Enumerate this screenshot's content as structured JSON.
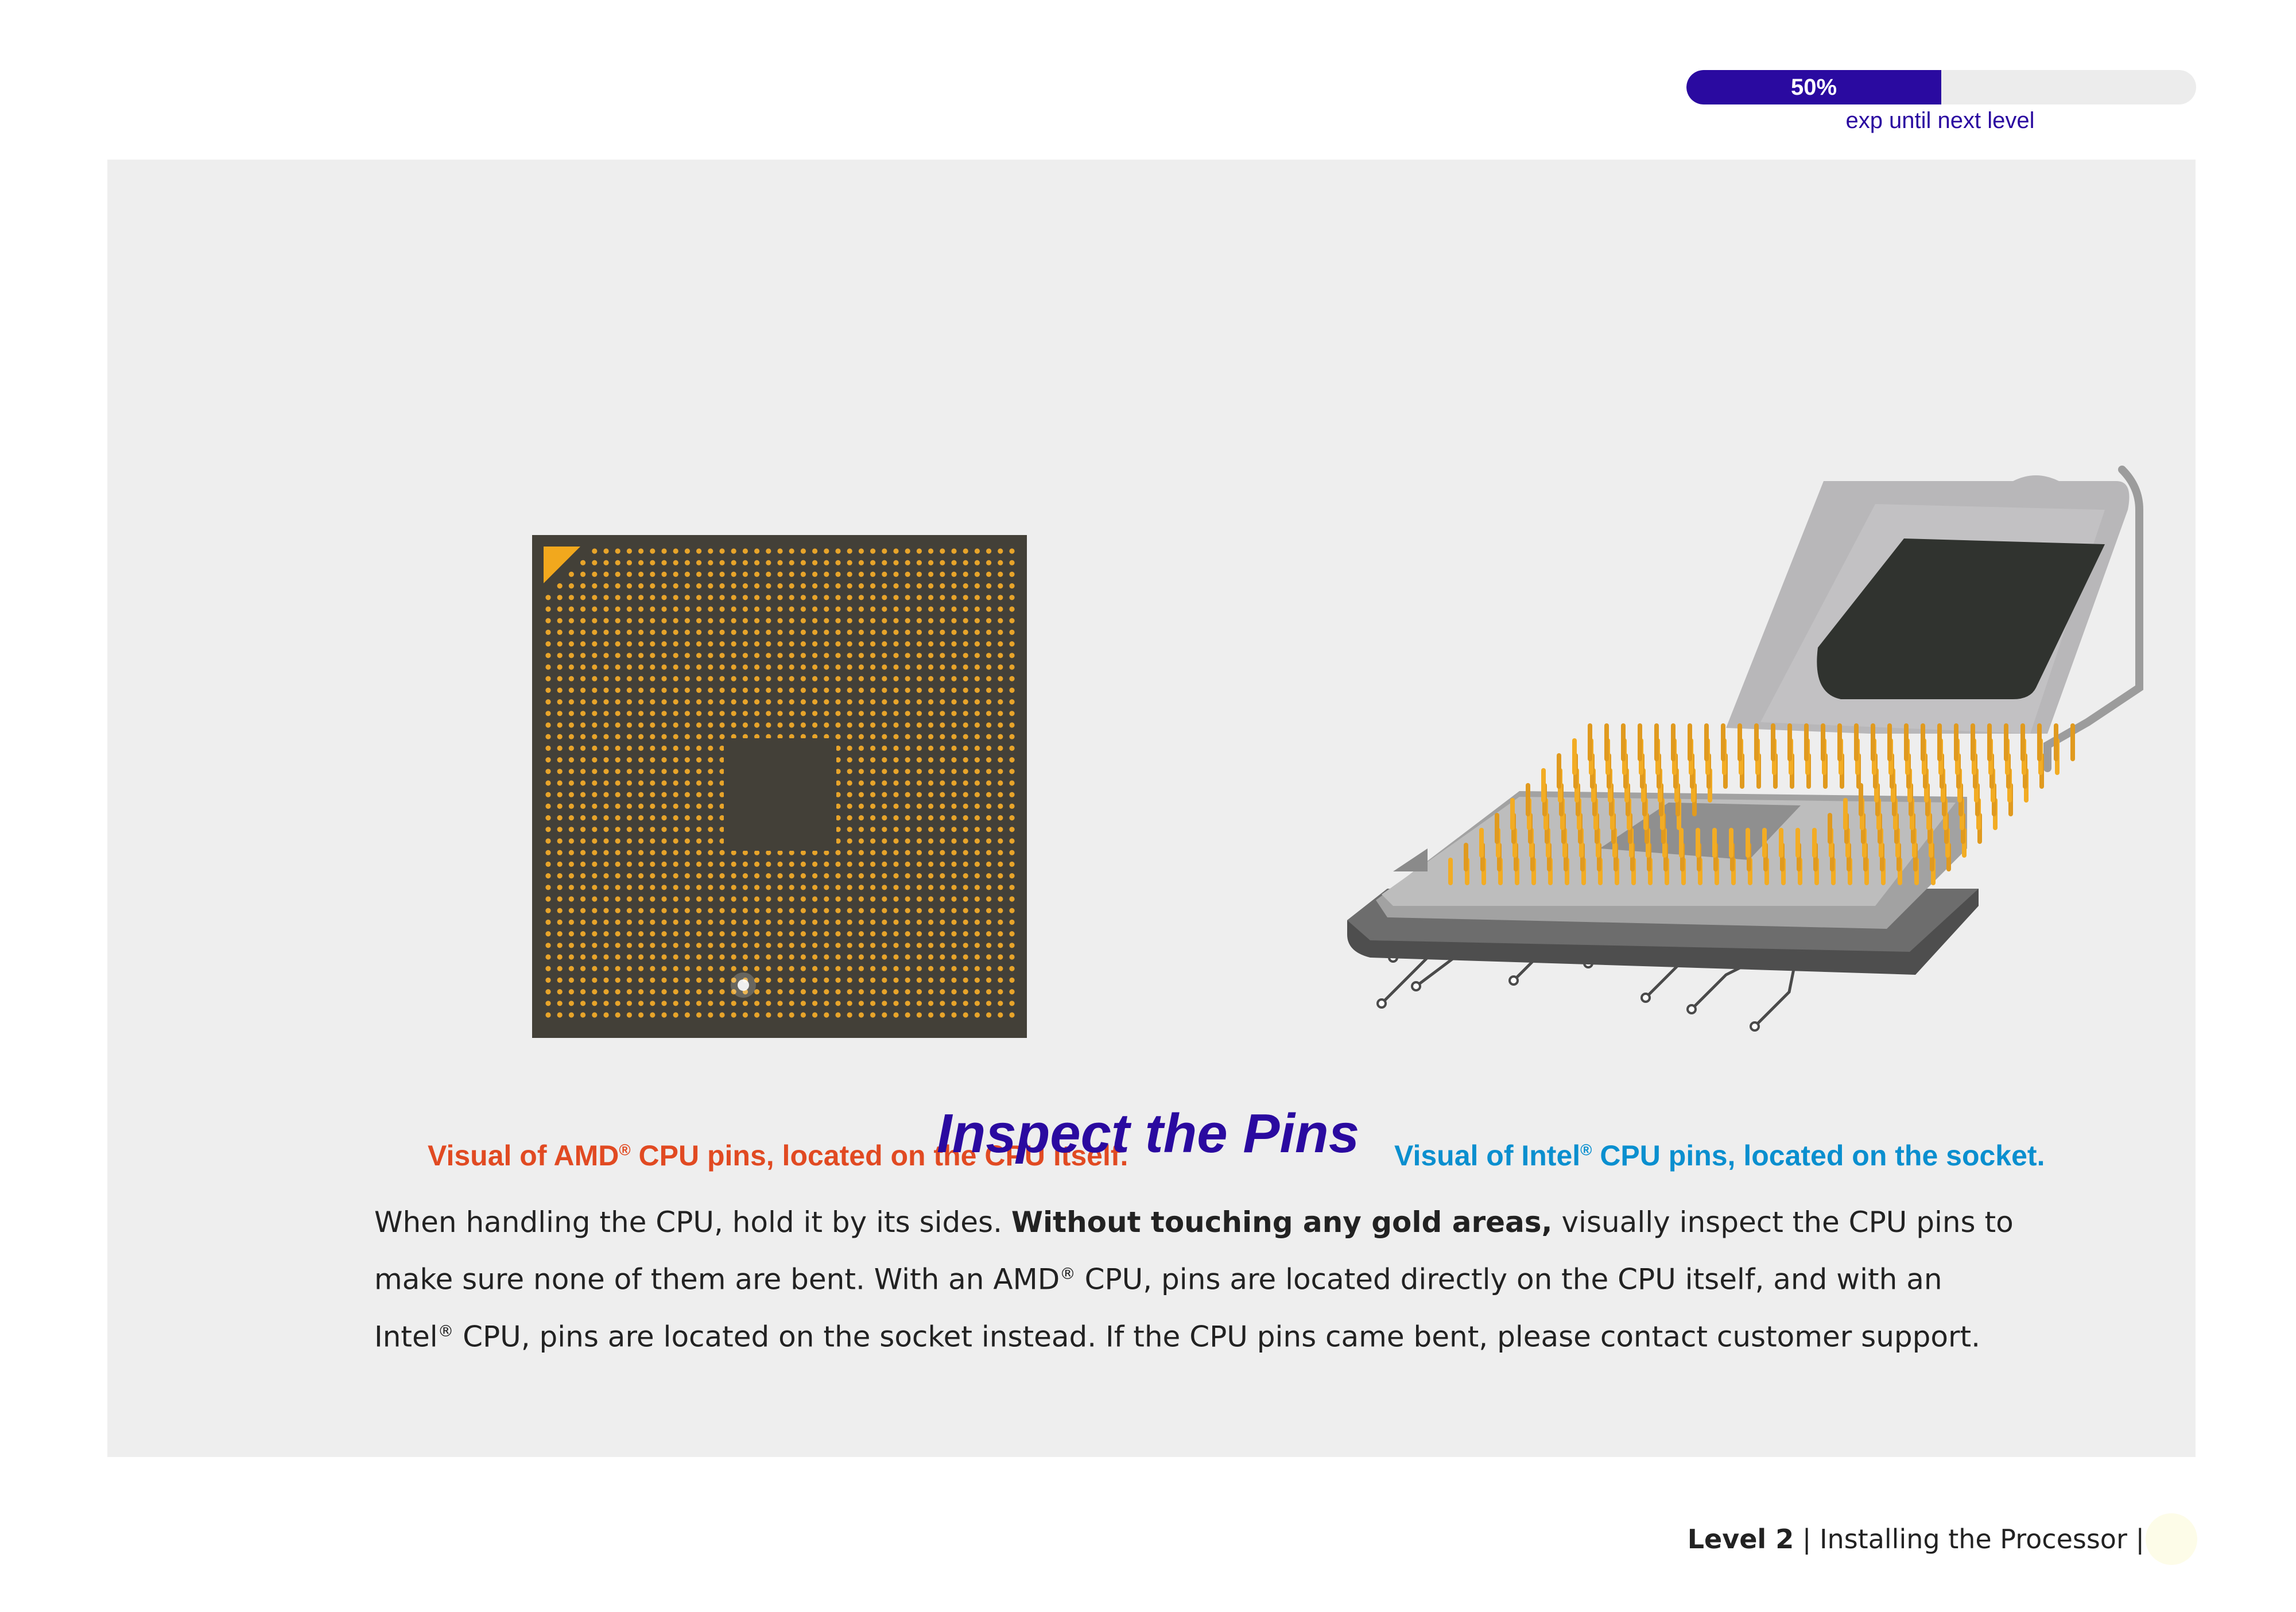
{
  "progress": {
    "percent_label": "50%",
    "value": 0.5,
    "subtitle": "exp until next level",
    "fill_color": "#2a0aa0"
  },
  "figures": {
    "amd_caption_a": "Visual of AMD",
    "amd_caption_reg": "®",
    "amd_caption_b": " CPU pins, located on the CPU itself.",
    "intel_caption_a": "Visual of Intel",
    "intel_caption_reg": "®",
    "intel_caption_b": " CPU pins, located on the socket."
  },
  "section": {
    "title": "Inspect the Pins",
    "line1_a": "When handling the CPU, hold it by its sides. ",
    "line1_bold": "Without touching any gold areas,",
    "line1_b": " visually inspect the CPU pins to",
    "line2_a": "make sure none of them are bent.  With an AMD",
    "line2_reg": "®",
    "line2_b": " CPU, pins are located directly on the CPU itself, and with an",
    "line3_a": "Intel",
    "line3_reg": "®",
    "line3_b": " CPU, pins are located on the socket instead. If the CPU pins came bent, please contact customer support."
  },
  "footer": {
    "level": "Level 2",
    "sep1": " | ",
    "chapter": "Installing the Processor",
    "sep2": " |"
  },
  "colors": {
    "accent": "#2a0aa0",
    "amd_caption": "#e14a22",
    "intel_caption": "#0a8fcf",
    "panel_bg": "#eeeeee",
    "gold": "#f2a81d"
  }
}
